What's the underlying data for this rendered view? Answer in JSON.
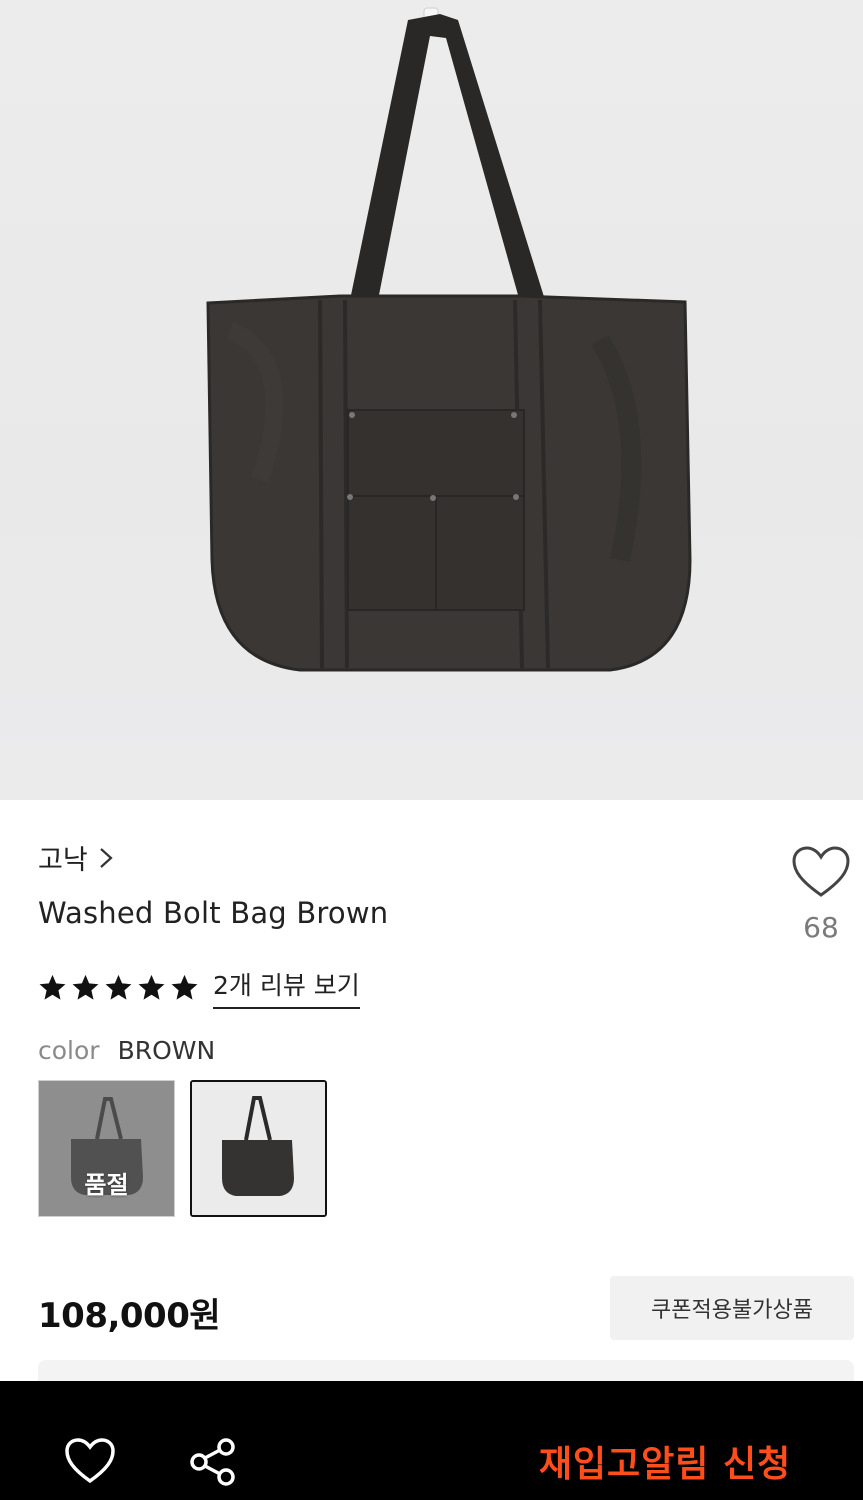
{
  "product": {
    "brand": "고낙",
    "name": "Washed Bolt Bag Brown",
    "like_count": "68",
    "rating_stars": 5,
    "review_link": "2개 리뷰 보기",
    "option_label": "color",
    "option_value": "BROWN",
    "swatches": [
      {
        "status": "품절"
      },
      {
        "status": ""
      }
    ],
    "price": "108,000원",
    "coupon_badge": "쿠폰적용불가상품"
  },
  "bottom_bar": {
    "restock_button": "재입고알림 신청"
  },
  "colors": {
    "accent": "#ff4e1c",
    "bar_background": "#000000",
    "text_primary": "#222222",
    "text_muted": "#8a8a8a"
  },
  "icons": [
    "chevron-right-icon",
    "heart-outline-icon",
    "star-icon",
    "share-icon"
  ]
}
